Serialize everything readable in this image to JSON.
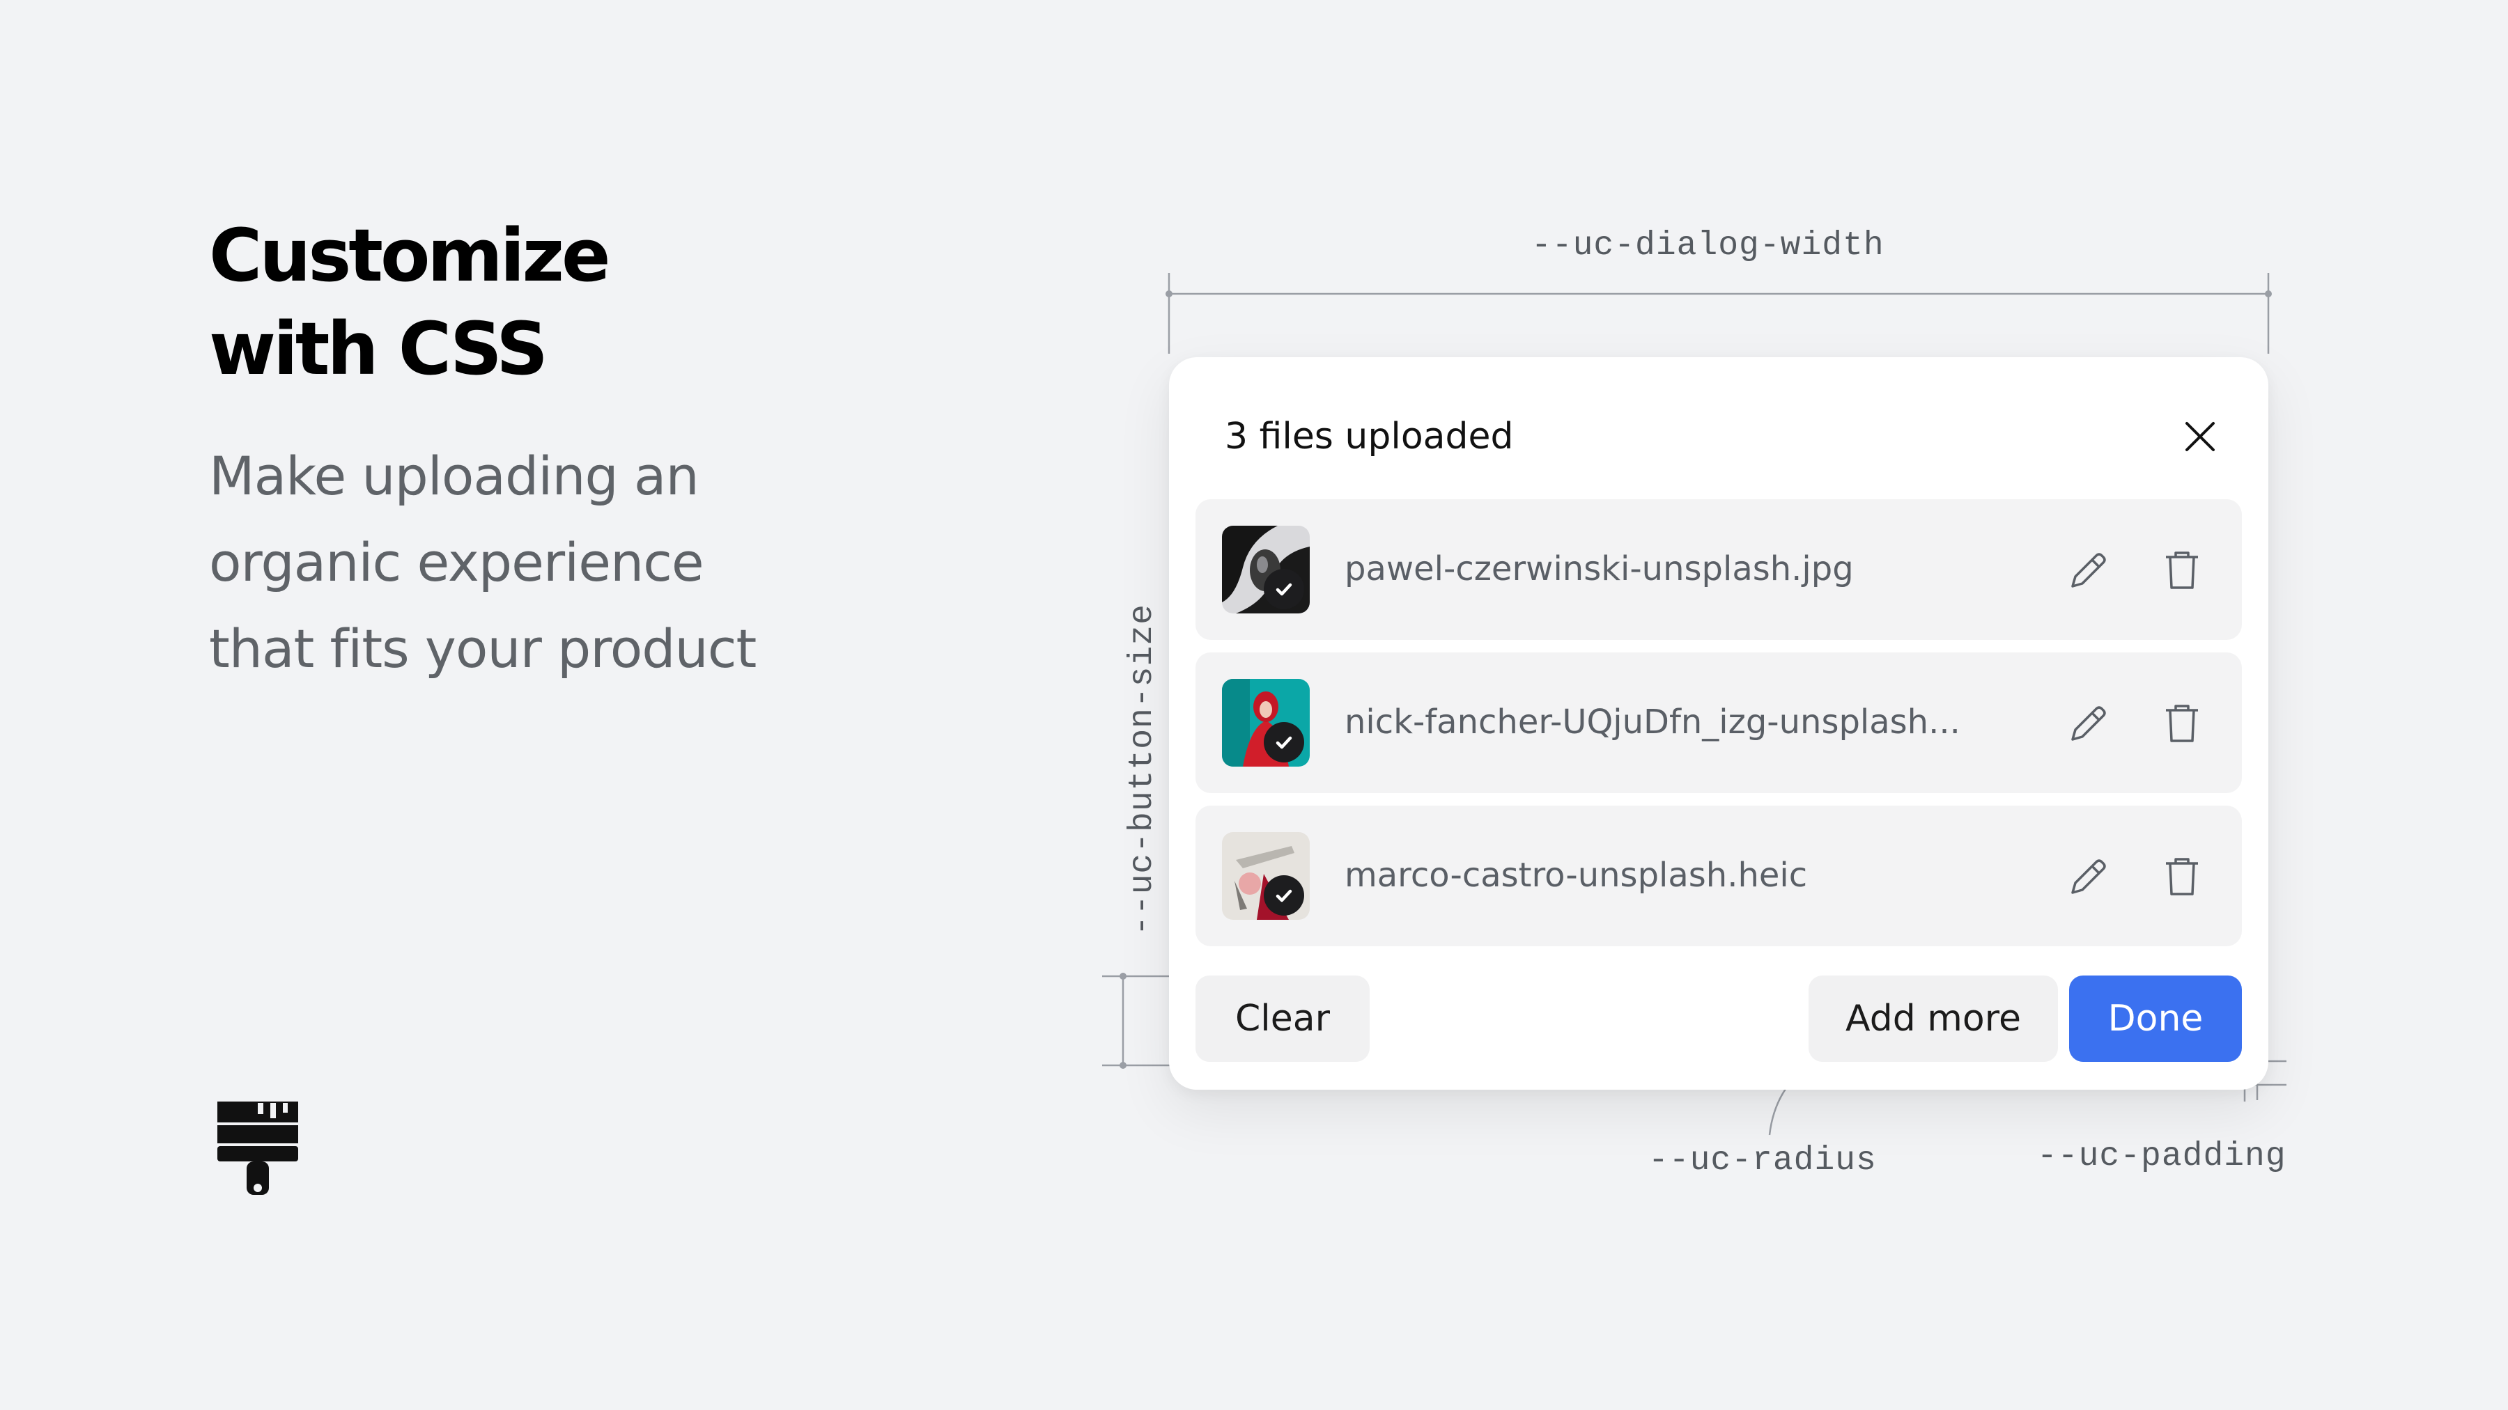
{
  "hero": {
    "title_line1": "Customize",
    "title_line2": "with CSS",
    "subtitle_line1": "Make uploading an",
    "subtitle_line2": "organic experience",
    "subtitle_line3": "that fits your product",
    "icon": "paintbrush-icon"
  },
  "annotations": {
    "dialog_width": "--uc-dialog-width",
    "button_size": "--uc-button-size",
    "radius": "--uc-radius",
    "padding": "--uc-padding"
  },
  "dialog": {
    "title": "3 files uploaded",
    "close_icon": "close-icon",
    "files": [
      {
        "name": "pawel-czerwinski-unsplash.jpg",
        "status_icon": "check-icon",
        "edit_icon": "pencil-icon",
        "delete_icon": "trash-icon"
      },
      {
        "name": "nick-fancher-UQjuDfn_izg-unsplash...",
        "status_icon": "check-icon",
        "edit_icon": "pencil-icon",
        "delete_icon": "trash-icon"
      },
      {
        "name": "marco-castro-unsplash.heic",
        "status_icon": "check-icon",
        "edit_icon": "pencil-icon",
        "delete_icon": "trash-icon"
      }
    ],
    "buttons": {
      "clear": "Clear",
      "add_more": "Add more",
      "done": "Done"
    }
  },
  "colors": {
    "background": "#f2f3f5",
    "dialog": "#ffffff",
    "row": "#f3f3f4",
    "primary": "#3b71f0",
    "secondary_button": "#f1f1f2",
    "text_muted": "#5a5f66"
  }
}
